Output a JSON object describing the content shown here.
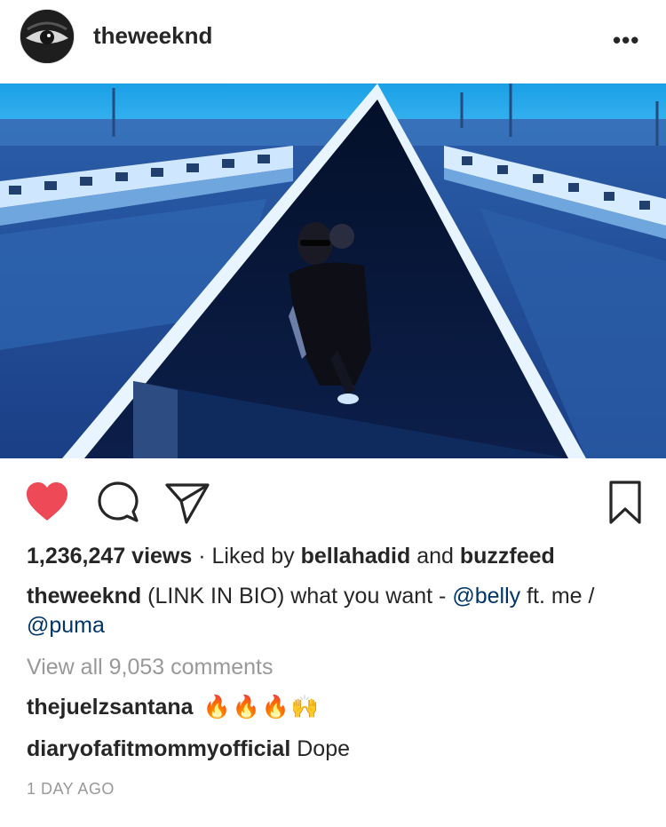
{
  "post": {
    "username": "theweeknd",
    "more_icon": "•••",
    "views": "1,236,247 views",
    "separator": "·",
    "liked_by_prefix": "Liked by",
    "liked_user_1": "bellahadid",
    "liked_and": "and",
    "liked_user_2": "buzzfeed",
    "caption_user": "theweeknd",
    "caption_text_1": "(LINK IN BIO) what you want -",
    "caption_mention_1": "@belly",
    "caption_text_2": "ft. me /",
    "caption_mention_2": "@puma",
    "view_all_comments": "View all 9,053 comments",
    "comments": [
      {
        "user": "thejuelzsantana",
        "text": "🔥🔥🔥🙌"
      },
      {
        "user": "diaryofafitmommyofficial",
        "text": "Dope"
      }
    ],
    "timestamp": "1 DAY AGO"
  },
  "icons": {
    "like": "heart-filled-icon",
    "comment": "comment-bubble-icon",
    "share": "paper-plane-icon",
    "save": "bookmark-icon"
  },
  "colors": {
    "like_red": "#ed4956",
    "link_blue": "#003569",
    "muted_gray": "#999999",
    "text": "#262626"
  }
}
